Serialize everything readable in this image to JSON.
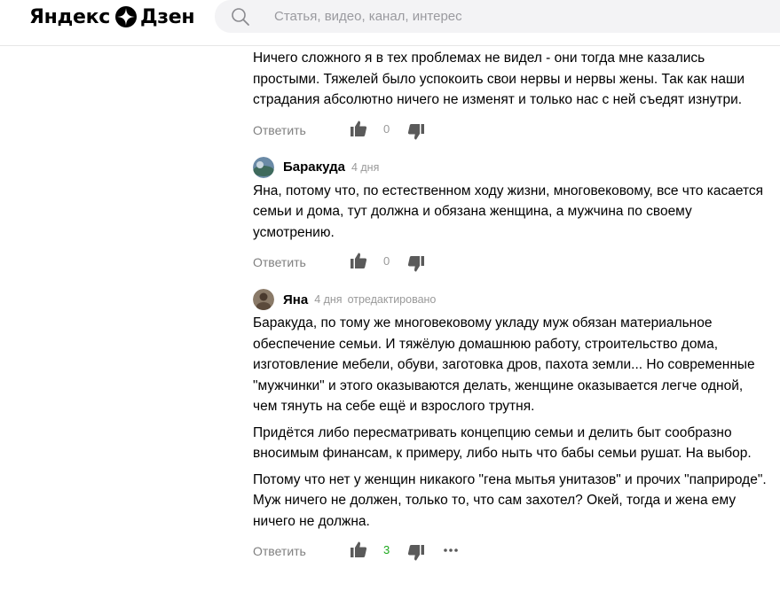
{
  "header": {
    "logo_text_left": "Яндекс",
    "logo_text_right": "Дзен",
    "search_placeholder": "Статья, видео, канал, интерес"
  },
  "comments": [
    {
      "paragraphs": [
        "Ничего сложного я в тех проблемах не видел - они тогда мне казались простыми. Тяжелей было успокоить свои нервы и нервы жены. Так как наши страдания абсолютно ничего не изменят и только нас с ней съедят изнутри."
      ],
      "reply_label": "Ответить",
      "likes": "0"
    },
    {
      "author": "Баракуда",
      "time": "4 дня",
      "paragraphs": [
        "Яна, потому что, по естественном ходу жизни, многовековому, все что касается семьи и дома, тут должна и обязана женщина, а мужчина по своему усмотрению."
      ],
      "reply_label": "Ответить",
      "likes": "0"
    },
    {
      "author": "Яна",
      "time": "4 дня",
      "edited": "отредактировано",
      "paragraphs": [
        "Баракуда, по тому же многовековому укладу муж обязан материальное обеспечение семьи. И тяжёлую домашнюю работу, строительство дома, изготовление мебели, обуви, заготовка дров, пахота земли... Но современные \"мужчинки\" и этого оказываются делать, женщине оказывается легче одной, чем тянуть на себе ещё и взрослого трутня.",
        "Придётся либо пересматривать концепцию семьи и делить быт сообразно вносимым финансам, к примеру, либо ныть что бабы семьи рушат. На выбор.",
        "Потому что нет у женщин никакого \"гена мытья унитазов\" и прочих \"паприроде\". Муж ничего не должен, только то, что сам захотел? Окей, тогда и жена ему ничего не должна."
      ],
      "reply_label": "Ответить",
      "likes": "3"
    }
  ]
}
